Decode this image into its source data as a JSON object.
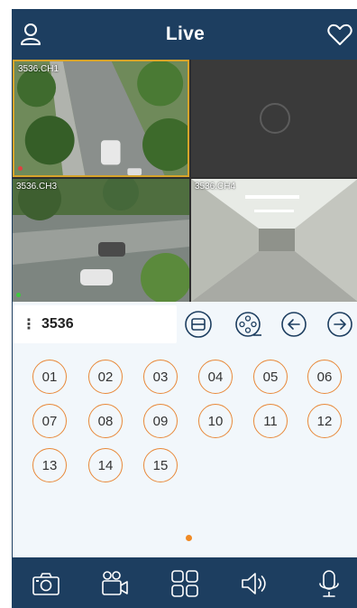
{
  "header": {
    "title": "Live",
    "left_icon": "user-icon",
    "right_icon": "heart-icon",
    "bg_color": "#1d3e60"
  },
  "video_grid": {
    "tiles": [
      {
        "label": "3536.CH1",
        "selected": true
      },
      {
        "label": "",
        "empty": true,
        "icon": "camera-placeholder-icon"
      },
      {
        "label": "3536.CH3"
      },
      {
        "label": "3536.CH4"
      }
    ],
    "selected_border_color": "#d7a42a"
  },
  "device_bar": {
    "device_name": "3536",
    "menu_icon": "more-vertical-icon",
    "controls": [
      "fit-screen-icon",
      "film-reel-icon",
      "arrow-left-icon",
      "arrow-right-icon"
    ]
  },
  "channels": [
    "01",
    "02",
    "03",
    "04",
    "05",
    "06",
    "07",
    "08",
    "09",
    "10",
    "11",
    "12",
    "13",
    "14",
    "15"
  ],
  "channel_border_color": "#e8893a",
  "pager": {
    "active_color": "#f08a24"
  },
  "toolbar": {
    "items": [
      "camera-icon",
      "video-record-icon",
      "grid-layout-icon",
      "speaker-icon",
      "microphone-icon"
    ]
  }
}
